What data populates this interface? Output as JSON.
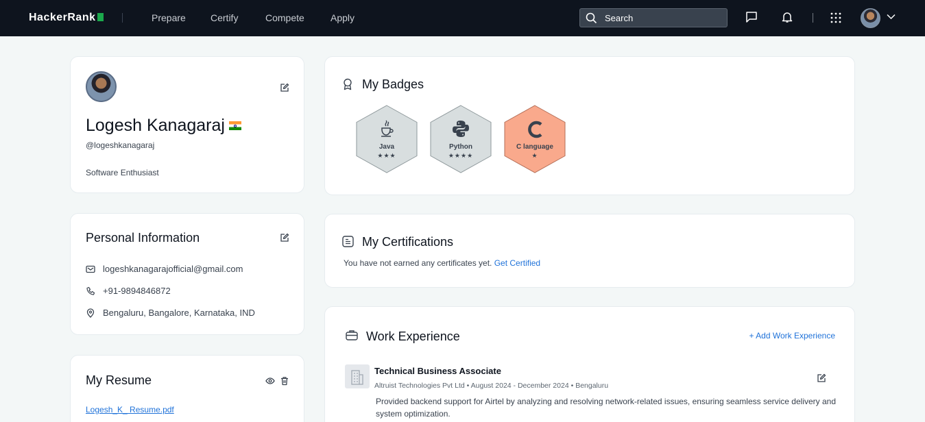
{
  "nav": {
    "logo": "HackerRank",
    "links": [
      "Prepare",
      "Certify",
      "Compete",
      "Apply"
    ],
    "search_placeholder": "Search"
  },
  "profile": {
    "name": "Logesh Kanagaraj",
    "handle": "@logeshkanagaraj",
    "bio": "Software Enthusiast"
  },
  "personal_info": {
    "title": "Personal Information",
    "email": "logeshkanagarajofficial@gmail.com",
    "phone": "+91-9894846872",
    "location": "Bengaluru, Bangalore, Karnataka, IND"
  },
  "resume": {
    "title": "My Resume",
    "file": "Logesh_K_ Resume.pdf"
  },
  "badges": {
    "title": "My Badges",
    "items": [
      {
        "label": "Java",
        "stars": "★★★",
        "color": "#d8dedf"
      },
      {
        "label": "Python",
        "stars": "★★★★",
        "color": "#d8dedf"
      },
      {
        "label": "C language",
        "stars": "★",
        "color": "#f9a98c"
      }
    ]
  },
  "certifications": {
    "title": "My Certifications",
    "text": "You have not earned any certificates yet.",
    "link": "Get Certified"
  },
  "work": {
    "title": "Work Experience",
    "add_label": "+ Add Work Experience",
    "job_title": "Technical Business Associate",
    "company": "Altruist Technologies Pvt Ltd",
    "dates": "August 2024 - December 2024",
    "location": "Bengaluru",
    "description": "Provided backend support for Airtel by analyzing and resolving network-related issues, ensuring seamless service delivery and system optimization."
  }
}
